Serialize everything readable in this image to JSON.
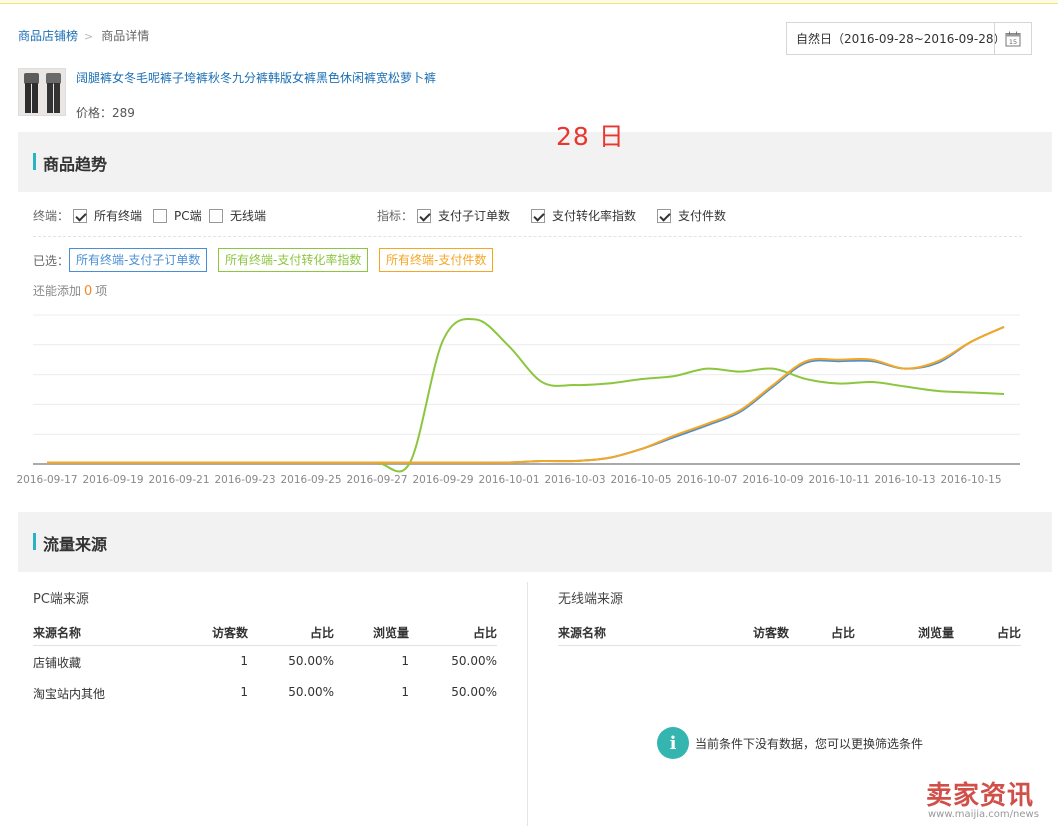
{
  "breadcrumb": {
    "root": "商品店铺榜",
    "current": "商品详情"
  },
  "date_range": {
    "label": "自然日（2016-09-28~2016-09-28）",
    "calendar_day": "15"
  },
  "product": {
    "title": "阔腿裤女冬毛呢裤子垮裤秋冬九分裤韩版女裤黑色休闲裤宽松萝卜裤",
    "price": "价格：289"
  },
  "overlay_day": "28 日",
  "trend_section": {
    "title": "商品趋势"
  },
  "terminal": {
    "label": "终端：",
    "options": [
      {
        "label": "所有终端",
        "checked": true
      },
      {
        "label": "PC端",
        "checked": false
      },
      {
        "label": "无线端",
        "checked": false
      }
    ]
  },
  "metrics": {
    "label": "指标：",
    "options": [
      {
        "label": "支付子订单数",
        "checked": true
      },
      {
        "label": "支付转化率指数",
        "checked": true
      },
      {
        "label": "支付件数",
        "checked": true
      }
    ]
  },
  "selected": {
    "label": "已选：",
    "tags": [
      {
        "label": "所有终端-支付子订单数",
        "color": "#4a8fd6"
      },
      {
        "label": "所有终端-支付转化率指数",
        "color": "#8cc63f"
      },
      {
        "label": "所有终端-支付件数",
        "color": "#f5a623"
      }
    ]
  },
  "can_add": {
    "prefix": "还能添加",
    "count": "0",
    "suffix": "项"
  },
  "chart_data": {
    "type": "line",
    "x": [
      "2016-09-17",
      "2016-09-18",
      "2016-09-19",
      "2016-09-20",
      "2016-09-21",
      "2016-09-22",
      "2016-09-23",
      "2016-09-24",
      "2016-09-25",
      "2016-09-26",
      "2016-09-27",
      "2016-09-28",
      "2016-09-29",
      "2016-09-30",
      "2016-10-01",
      "2016-10-02",
      "2016-10-03",
      "2016-10-04",
      "2016-10-05",
      "2016-10-06",
      "2016-10-07",
      "2016-10-08",
      "2016-10-09",
      "2016-10-10",
      "2016-10-11",
      "2016-10-12",
      "2016-10-13",
      "2016-10-14",
      "2016-10-15",
      "2016-10-16"
    ],
    "x_tick_labels": [
      "2016-09-17",
      "2016-09-19",
      "2016-09-21",
      "2016-09-23",
      "2016-09-25",
      "2016-09-27",
      "2016-09-29",
      "2016-10-01",
      "2016-10-03",
      "2016-10-05",
      "2016-10-07",
      "2016-10-09",
      "2016-10-11",
      "2016-10-13",
      "2016-10-15"
    ],
    "ylim": [
      0,
      5
    ],
    "grid": true,
    "series": [
      {
        "name": "所有终端-支付子订单数",
        "color": "#4a8fd6",
        "values": [
          0.05,
          0.05,
          0.05,
          0.05,
          0.05,
          0.05,
          0.05,
          0.05,
          0.05,
          0.05,
          0.05,
          0.05,
          0.05,
          0.05,
          0.05,
          0.1,
          0.1,
          0.2,
          0.5,
          0.9,
          1.3,
          1.75,
          2.6,
          3.4,
          3.45,
          3.45,
          3.2,
          3.4,
          4.1,
          4.6
        ]
      },
      {
        "name": "所有终端-支付转化率指数",
        "color": "#8cc63f",
        "values": [
          0.05,
          0.05,
          0.05,
          0.05,
          0.05,
          0.05,
          0.05,
          0.05,
          0.05,
          0.05,
          0.05,
          0.05,
          4.15,
          4.85,
          3.95,
          2.75,
          2.65,
          2.7,
          2.85,
          2.95,
          3.2,
          3.1,
          3.2,
          2.85,
          2.7,
          2.75,
          2.6,
          2.45,
          2.4,
          2.35
        ]
      },
      {
        "name": "所有终端-支付件数",
        "color": "#f5a623",
        "values": [
          0.05,
          0.05,
          0.05,
          0.05,
          0.05,
          0.05,
          0.05,
          0.05,
          0.05,
          0.05,
          0.05,
          0.05,
          0.05,
          0.05,
          0.05,
          0.1,
          0.1,
          0.2,
          0.5,
          0.95,
          1.35,
          1.8,
          2.65,
          3.45,
          3.5,
          3.5,
          3.2,
          3.45,
          4.1,
          4.6
        ]
      }
    ]
  },
  "traffic_section": {
    "title": "流量来源"
  },
  "pc_sources": {
    "title": "PC端来源",
    "headers": [
      "来源名称",
      "访客数",
      "占比",
      "浏览量",
      "占比"
    ],
    "rows": [
      [
        "店铺收藏",
        "1",
        "50.00%",
        "1",
        "50.00%"
      ],
      [
        "淘宝站内其他",
        "1",
        "50.00%",
        "1",
        "50.00%"
      ]
    ]
  },
  "mobile_sources": {
    "title": "无线端来源",
    "headers": [
      "来源名称",
      "访客数",
      "占比",
      "浏览量",
      "占比"
    ],
    "empty_text": "当前条件下没有数据，您可以更换筛选条件"
  },
  "watermark": {
    "brand": "卖家资讯",
    "url": "www.maijia.com/news"
  }
}
